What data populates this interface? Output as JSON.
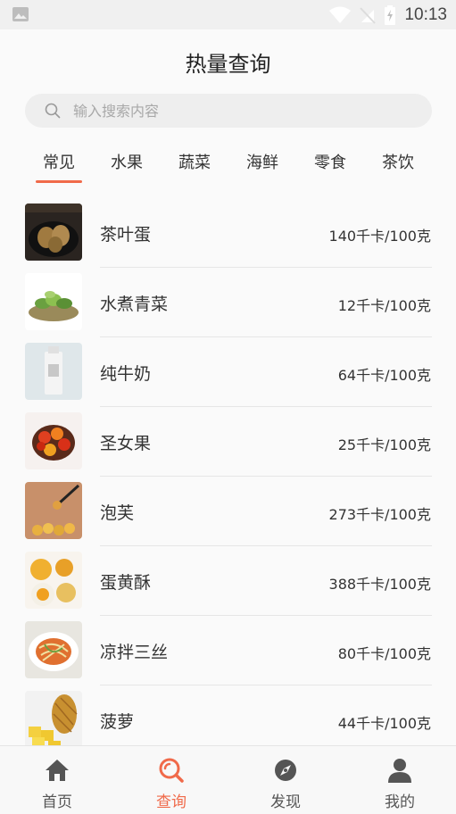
{
  "status_bar": {
    "time": "10:13"
  },
  "header": {
    "title": "热量查询"
  },
  "search": {
    "placeholder": "输入搜索内容"
  },
  "tabs": [
    {
      "label": "常见",
      "active": true
    },
    {
      "label": "水果"
    },
    {
      "label": "蔬菜"
    },
    {
      "label": "海鲜"
    },
    {
      "label": "零食"
    },
    {
      "label": "茶饮"
    }
  ],
  "foods": [
    {
      "name": "茶叶蛋",
      "calories": "140千卡/100克"
    },
    {
      "name": "水煮青菜",
      "calories": "12千卡/100克"
    },
    {
      "name": "纯牛奶",
      "calories": "64千卡/100克"
    },
    {
      "name": "圣女果",
      "calories": "25千卡/100克"
    },
    {
      "name": "泡芙",
      "calories": "273千卡/100克"
    },
    {
      "name": "蛋黄酥",
      "calories": "388千卡/100克"
    },
    {
      "name": "凉拌三丝",
      "calories": "80千卡/100克"
    },
    {
      "name": "菠萝",
      "calories": "44千卡/100克"
    }
  ],
  "bottom_nav": [
    {
      "label": "首页",
      "icon": "home-icon"
    },
    {
      "label": "查询",
      "icon": "search-icon",
      "active": true
    },
    {
      "label": "发现",
      "icon": "compass-icon"
    },
    {
      "label": "我的",
      "icon": "user-icon"
    }
  ],
  "colors": {
    "accent": "#f06a4a",
    "icon_gray": "#555555"
  }
}
